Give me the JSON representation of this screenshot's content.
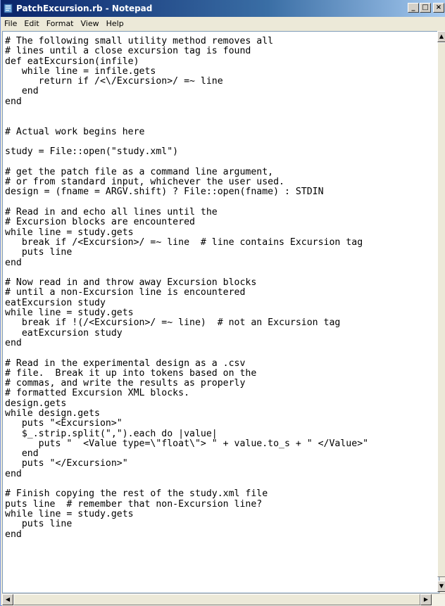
{
  "window": {
    "title": "PatchExcursion.rb - Notepad",
    "controls": {
      "minimize": "_",
      "maximize": "□",
      "close": "×"
    }
  },
  "menu": [
    "File",
    "Edit",
    "Format",
    "View",
    "Help"
  ],
  "editor": {
    "lines": [
      "# The following small utility method removes all",
      "# lines until a close excursion tag is found",
      "def eatExcursion(infile)",
      "   while line = infile.gets",
      "      return if /<\\/Excursion>/ =~ line",
      "   end",
      "end",
      "",
      "",
      "# Actual work begins here",
      "",
      "study = File::open(\"study.xml\")",
      "",
      "# get the patch file as a command line argument,",
      "# or from standard input, whichever the user used.",
      "design = (fname = ARGV.shift) ? File::open(fname) : STDIN",
      "",
      "# Read in and echo all lines until the",
      "# Excursion blocks are encountered",
      "while line = study.gets",
      "   break if /<Excursion>/ =~ line  # line contains Excursion tag",
      "   puts line",
      "end",
      "",
      "# Now read in and throw away Excursion blocks",
      "# until a non-Excursion line is encountered",
      "eatExcursion study",
      "while line = study.gets",
      "   break if !(/<Excursion>/ =~ line)  # not an Excursion tag",
      "   eatExcursion study",
      "end",
      "",
      "# Read in the experimental design as a .csv",
      "# file.  Break it up into tokens based on the",
      "# commas, and write the results as properly",
      "# formatted Excursion XML blocks.",
      "design.gets",
      "while design.gets",
      "   puts \"<Excursion>\"",
      "   $_.strip.split(\",\").each do |value|",
      "      puts \"  <Value type=\\\"float\\\"> \" + value.to_s + \" </Value>\"",
      "   end",
      "   puts \"</Excursion>\"",
      "end",
      "",
      "# Finish copying the rest of the study.xml file",
      "puts line  # remember that non-Excursion line?",
      "while line = study.gets",
      "   puts line",
      "end"
    ]
  },
  "icons": {
    "app": "notepad-icon",
    "scroll_up": "arrow-up-icon",
    "scroll_down": "arrow-down-icon",
    "scroll_left": "arrow-left-icon",
    "scroll_right": "arrow-right-icon"
  }
}
